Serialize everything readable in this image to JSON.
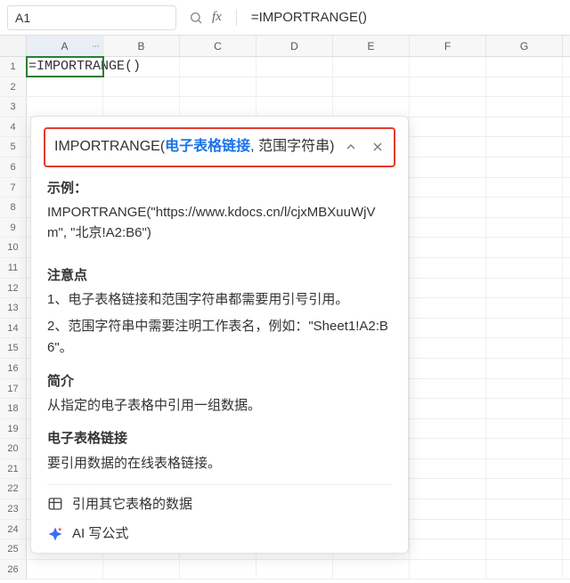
{
  "namebox": "A1",
  "fx_label": "fx",
  "formula_bar": "=IMPORTRANGE()",
  "columns": [
    "A",
    "B",
    "C",
    "D",
    "E",
    "F",
    "G"
  ],
  "column_dots": "···",
  "a1_content": "=IMPORTRANGE()",
  "row_count": 26,
  "popup": {
    "sig_fn": "IMPORTRANGE(",
    "sig_arg_active": "电子表格链接",
    "sig_sep": ", ",
    "sig_arg2": "范围字符串",
    "sig_close": ")",
    "example_title": "示例：",
    "example_body": "IMPORTRANGE(\"https://www.kdocs.cn/l/cjxMBXuuWjVm\", \"北京!A2:B6\")",
    "notes_title": "注意点",
    "notes_1": "1、电子表格链接和范围字符串都需要用引号引用。",
    "notes_2": "2、范围字符串中需要注明工作表名，例如：\"Sheet1!A2:B6\"。",
    "brief_title": "简介",
    "brief_body": "从指定的电子表格中引用一组数据。",
    "link_title": "电子表格链接",
    "link_body": "要引用数据的在线表格链接。",
    "footer_link": "引用其它表格的数据",
    "footer_ai": "AI 写公式"
  }
}
